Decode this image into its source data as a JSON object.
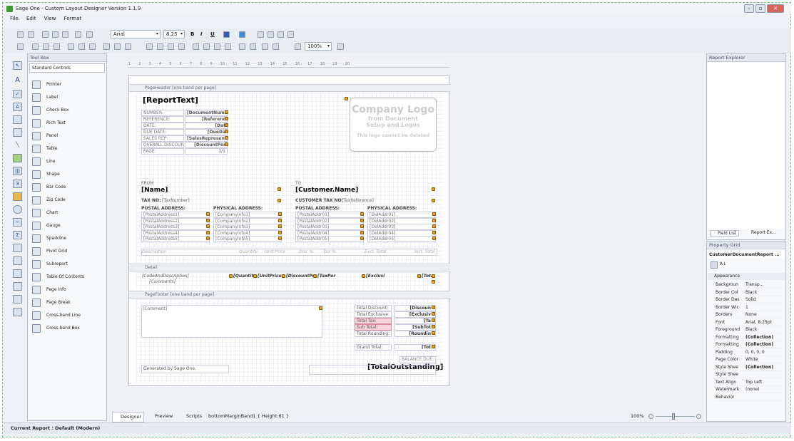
{
  "window": {
    "title": "Sage One - Custom Layout Designer Version 1.1.9"
  },
  "menu": [
    "File",
    "Edit",
    "View",
    "Format"
  ],
  "toolbar": {
    "font": "Arial",
    "size": "8.25",
    "bold": "B",
    "italic": "I",
    "underline": "U",
    "zoom": "100%"
  },
  "toolbox": {
    "title": "Tool Box",
    "group": "Standard Controls",
    "items": [
      "Pointer",
      "Label",
      "Check Box",
      "Rich Text",
      "Panel",
      "Table",
      "Line",
      "Shape",
      "Bar Code",
      "Zip Code",
      "Chart",
      "Gauge",
      "Sparkline",
      "Pivot Grid",
      "Subreport",
      "Table Of Contents",
      "Page Info",
      "Page Break",
      "Cross-band Line",
      "Cross-band Box"
    ]
  },
  "ruler": "1 · · · 2 · · · 3 · · · 4 · · · 5 · · · 6 · · · 7 · · · 8 · · · 9 · · · 10 · · · 11 · · · 12 · · · 13 · · · 14 · · · 15 · · · 16 · · · 17 · · · 18 · · · 19 · · · 20",
  "bands": {
    "header": "PageHeader [one band per page]",
    "detail": "Detail",
    "footer": "PageFooter [one band per page]"
  },
  "report": {
    "report_text": "[ReportText]",
    "logo": {
      "l1": "Company Logo",
      "l2": "from Document",
      "l3": "Setup and Logos",
      "l4": "This logo cannot be deleted"
    },
    "doc_labels": [
      "NUMBER:",
      "REFERENCE:",
      "DATE:",
      "DUE DATE:",
      "SALES REP:",
      "OVERALL DISCOUNT %:",
      "PAGE:"
    ],
    "doc_values": [
      "[DocumentNumbe",
      "[Referenc",
      "[Dat",
      "[DueDa",
      "[SalesRepresentati",
      "[DiscountPer",
      "1/1"
    ],
    "from": "FROM",
    "to": "TO",
    "name": "[Name]",
    "customer_name": "[Customer.Name]",
    "tax_no_label": "TAX NO:",
    "tax_no": "[TaxNumber]",
    "cust_tax_label": "CUSTOMER TAX NO:",
    "cust_tax": "[TaxReference]",
    "postal": "POSTAL ADDRESS:",
    "physical": "PHYSICAL ADDRESS:",
    "postal_addr": [
      "[PostalAddress1]",
      "[PostalAddress2]",
      "[PostalAddress3]",
      "[PostalAddress4]",
      "[PostalAddress5]"
    ],
    "company_info": [
      "[CompanyInfo1]",
      "[CompanyInfo2]",
      "[CompanyInfo3]",
      "[CompanyInfo4]",
      "[CompanyInfo5]"
    ],
    "postal_addr_cust": [
      "[PostalAddr01]",
      "[PostalAddr02]",
      "[PostalAddr03]",
      "[PostalAddr04]",
      "[PostalAddr05]"
    ],
    "del_addr": [
      "[DelAddr01]",
      "[DelAddr02]",
      "[DelAddr03]",
      "[DelAddr04]",
      "[DelAddr05]"
    ],
    "col_headers": [
      "Description",
      "Quantity",
      "Unit Price",
      "Disc %",
      "Tax %",
      "Excl. Total",
      "Incl. Total"
    ],
    "detail": [
      "[CodeAndDescription]",
      "[Quantit",
      "[UnitPrice",
      "[DiscountPe",
      "[TaxPer",
      "[Exclusi",
      "[Tota"
    ],
    "comments": "[Comments]",
    "comment": "[Comment]",
    "totals_labels": [
      "Total Discount:",
      "Total Exclusive:",
      "Total Tax:",
      "Sub Total:",
      "Total Rounding:",
      "Grand Total:"
    ],
    "totals_values": [
      "[Discoun",
      "[Exclusiv",
      "[Ta",
      "[SubTot",
      "[Roundin",
      "[Tot"
    ],
    "balance_due": "BALANCE DUE:",
    "total_outstanding": "[TotalOutstanding]",
    "generated": "Generated by Sage One."
  },
  "report_explorer": {
    "title": "Report Explorer",
    "tabs": [
      "Field List",
      "Report Ex..."
    ]
  },
  "property_grid": {
    "title": "Property Grid",
    "object": "CustomerDocumentReport ...",
    "category": "Appearance",
    "props": [
      [
        "Backgroun",
        "Transp..."
      ],
      [
        "Border Col",
        "Black"
      ],
      [
        "Border Das",
        "Solid"
      ],
      [
        "Border Wic",
        "1"
      ],
      [
        "Borders",
        "None"
      ],
      [
        "Font",
        "Arial, 8.25pt"
      ],
      [
        "Foreground",
        "Black"
      ],
      [
        "Formatting",
        "(Collection)"
      ],
      [
        "Formatting",
        "(Collection)"
      ],
      [
        "Padding",
        "0, 0, 0, 0"
      ],
      [
        "Page Color",
        "White"
      ],
      [
        "Style Shee",
        "(Collection)"
      ],
      [
        "Style Shee",
        ""
      ],
      [
        "Text Align",
        "Top Left"
      ],
      [
        "Watermark",
        "(none)"
      ],
      [
        "Behavior",
        ""
      ]
    ]
  },
  "bottom_tabs": [
    "Designer",
    "Preview",
    "Scripts"
  ],
  "band_info": "bottomMarginBand1 { Height:61 }",
  "zoom_status": "100%",
  "status": "Current Report : Default (Modern)"
}
